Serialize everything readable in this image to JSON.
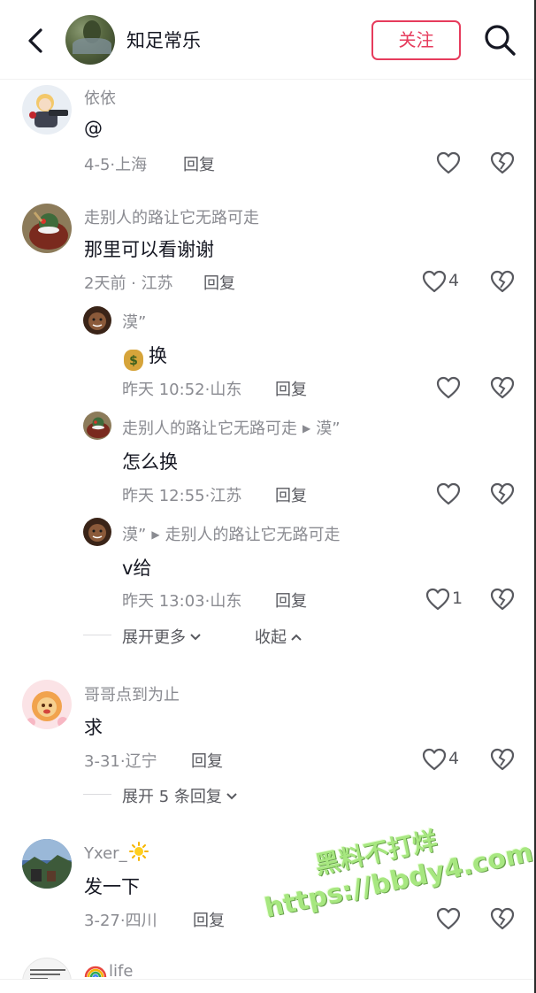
{
  "header": {
    "user_name": "知足常乐",
    "follow_label": "关注"
  },
  "comments": [
    {
      "user": "依依",
      "text": "@",
      "date": "4-5",
      "location": "上海",
      "reply_label": "回复",
      "likes": ""
    },
    {
      "user": "走别人的路让它无路可走",
      "text": "那里可以看谢谢",
      "date": "2天前",
      "location": "江苏",
      "reply_label": "回复",
      "likes": "4",
      "replies": [
        {
          "user": "漠”",
          "reply_to": "",
          "text": "换",
          "date": "昨天 10:52",
          "location": "山东",
          "reply_label": "回复",
          "likes": ""
        },
        {
          "user": "走别人的路让它无路可走",
          "reply_to": "漠”",
          "text": "怎么换",
          "date": "昨天 12:55",
          "location": "江苏",
          "reply_label": "回复",
          "likes": ""
        },
        {
          "user": "漠”",
          "reply_to": "走别人的路让它无路可走",
          "text": "v给",
          "date": "昨天 13:03",
          "location": "山东",
          "reply_label": "回复",
          "likes": "1"
        }
      ],
      "expand_more_label": "展开更多",
      "collapse_label": "收起"
    },
    {
      "user": "哥哥点到为止",
      "text": "求",
      "date": "3-31",
      "location": "辽宁",
      "reply_label": "回复",
      "likes": "4",
      "expand_replies_label": "展开 5 条回复"
    },
    {
      "user": "Yxer_",
      "text": "发一下",
      "date": "3-27",
      "location": "四川",
      "reply_label": "回复",
      "likes": ""
    },
    {
      "user": "life"
    }
  ],
  "watermark": {
    "line1": "黑料不打烊",
    "line2": "https://bbdy4.com"
  },
  "icons": {
    "back": "chevron-left-icon",
    "search": "search-icon",
    "like": "heart-outline-icon",
    "dislike": "broken-heart-icon"
  },
  "colors": {
    "accent": "#e63b5c",
    "muted_text": "#8a8b91",
    "primary_text": "#161823"
  }
}
